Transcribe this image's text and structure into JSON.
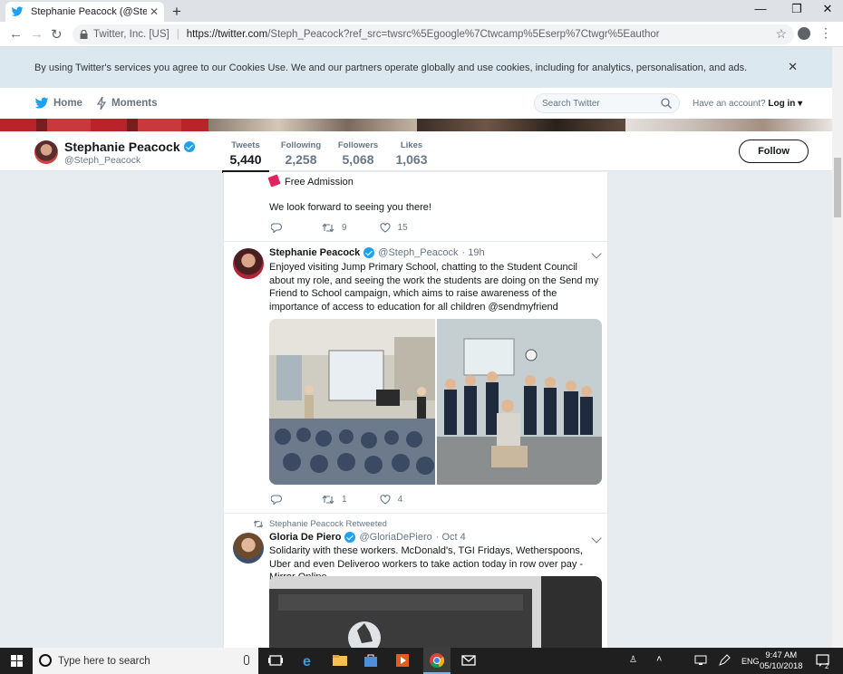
{
  "browser": {
    "tab_title": "Stephanie Peacock (@Steph_Pea",
    "tab_close": "✕",
    "new_tab": "+",
    "cert_label": "Twitter, Inc. [US]",
    "url_host": "https://twitter.com",
    "url_path": "/Steph_Peacock?ref_src=twsrc%5Egoogle%7Ctwcamp%5Eserp%7Ctwgr%5Eauthor",
    "min": "—",
    "max": "❐",
    "close": "✕"
  },
  "cookies": {
    "text": "By using Twitter's services you agree to our Cookies Use. We and our partners operate globally and use cookies, including for analytics, personalisation, and ads.",
    "close": "✕"
  },
  "topnav": {
    "home": "Home",
    "moments": "Moments",
    "search_placeholder": "Search Twitter",
    "have_account": "Have an account?",
    "login": "Log in"
  },
  "profile": {
    "name": "Stephanie Peacock",
    "handle": "@Steph_Peacock",
    "stats": [
      {
        "label": "Tweets",
        "value": "5,440"
      },
      {
        "label": "Following",
        "value": "2,258"
      },
      {
        "label": "Followers",
        "value": "5,068"
      },
      {
        "label": "Likes",
        "value": "1,063"
      }
    ],
    "follow_label": "Follow"
  },
  "tweet0": {
    "line1": "Free Admission",
    "line2": "We look forward to seeing you there!",
    "retweets": "9",
    "likes": "15"
  },
  "tweet1": {
    "name": "Stephanie Peacock",
    "handle": "@Steph_Peacock",
    "time": "· 19h",
    "text": "Enjoyed visiting Jump Primary School, chatting to the Student Council about my role, and seeing the work the students are doing on the Send my Friend to School campaign, which aims to raise awareness of the importance of access to education for all children @sendmyfriend",
    "retweets": "1",
    "likes": "4"
  },
  "tweet2": {
    "retweeted_by": "Stephanie Peacock Retweeted",
    "name": "Gloria De Piero",
    "handle": "@GloriaDePiero",
    "time": "· Oct 4",
    "text": "Solidarity with these workers. McDonald's, TGI Fridays, Wetherspoons, Uber and even Deliveroo workers to take action today in row over pay - Mirror Online"
  },
  "taskbar": {
    "search_placeholder": "Type here to search",
    "lang": "ENG",
    "time": "9:47 AM",
    "date": "05/10/2018",
    "notif_count": "2"
  },
  "colors": {
    "twitter_blue": "#1da1f2",
    "like_red": "#e0245e"
  }
}
